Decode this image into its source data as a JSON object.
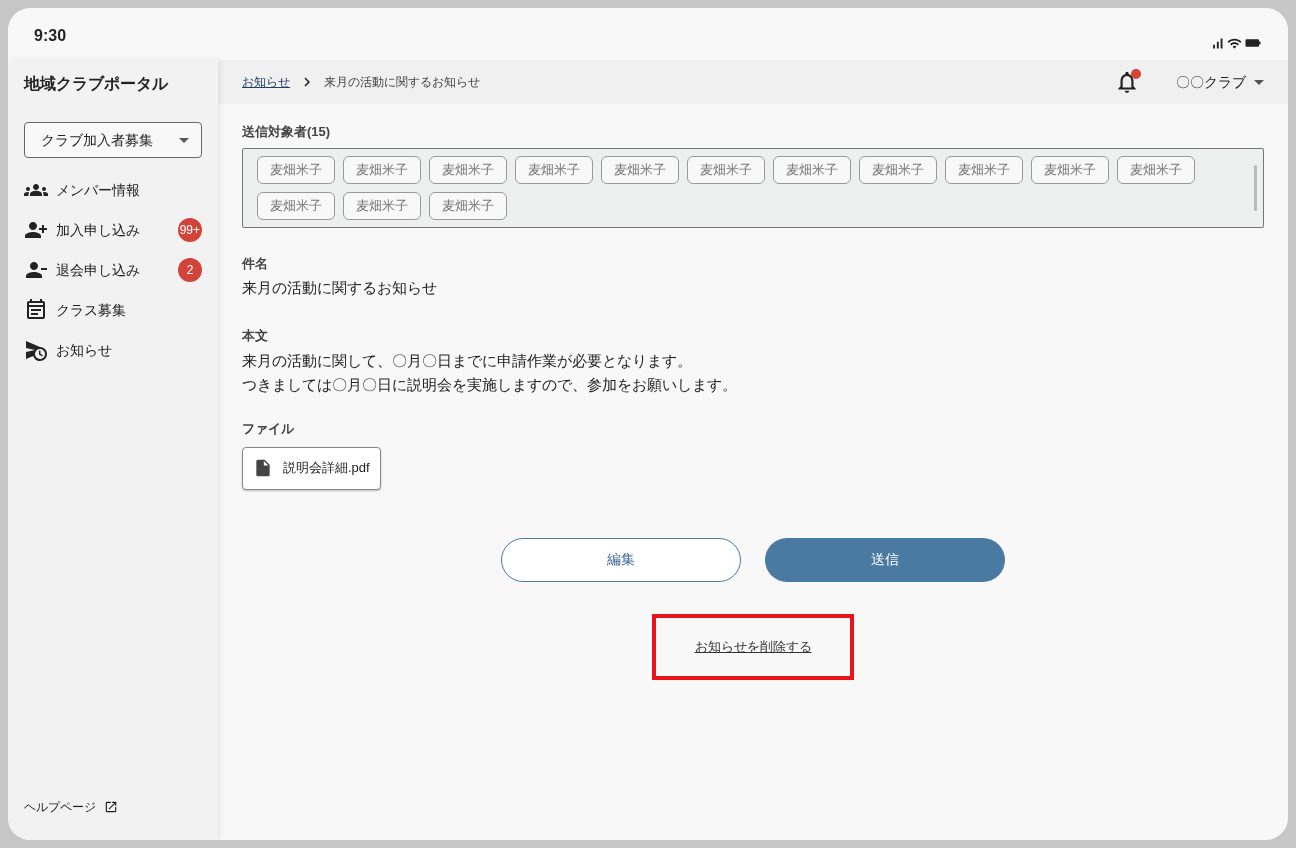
{
  "status_bar": {
    "time": "9:30"
  },
  "sidebar": {
    "title": "地域クラブポータル",
    "club_select": {
      "value": "クラブ加入者募集"
    },
    "items": [
      {
        "label": "メンバー情報",
        "selected": false
      },
      {
        "label": "加入申し込み",
        "badge": "99+",
        "selected": false
      },
      {
        "label": "退会申し込み",
        "badge": "2",
        "selected": false
      },
      {
        "label": "クラス募集",
        "selected": false
      },
      {
        "label": "お知らせ",
        "selected": false
      }
    ],
    "help_link": "ヘルプページ"
  },
  "header": {
    "breadcrumb": [
      {
        "label": "お知らせ",
        "kind": "link"
      },
      {
        "label": "来月の活動に関するお知らせ",
        "kind": "current"
      }
    ],
    "notification_unread": true,
    "club_menu": "〇〇クラブ"
  },
  "recipients": {
    "label": "送信対象者(15)",
    "chips": [
      "麦畑米子",
      "麦畑米子",
      "麦畑米子",
      "麦畑米子",
      "麦畑米子",
      "麦畑米子",
      "麦畑米子",
      "麦畑米子",
      "麦畑米子",
      "麦畑米子",
      "麦畑米子",
      "麦畑米子",
      "麦畑米子",
      "麦畑米子"
    ]
  },
  "subject": {
    "label": "件名",
    "value": "来月の活動に関するお知らせ"
  },
  "body": {
    "label": "本文",
    "lines": [
      "来月の活動に関して、〇月〇日までに申請作業が必要となります。",
      "つきましては〇月〇日に説明会を実施しますので、参加をお願いします。"
    ]
  },
  "file": {
    "label": "ファイル",
    "name": "説明会詳細.pdf"
  },
  "buttons": [
    {
      "label": "編集",
      "kind": "outline"
    },
    {
      "label": "送信",
      "kind": "primary"
    }
  ],
  "delete_link": {
    "label": "お知らせを削除する",
    "highlighted": true
  }
}
